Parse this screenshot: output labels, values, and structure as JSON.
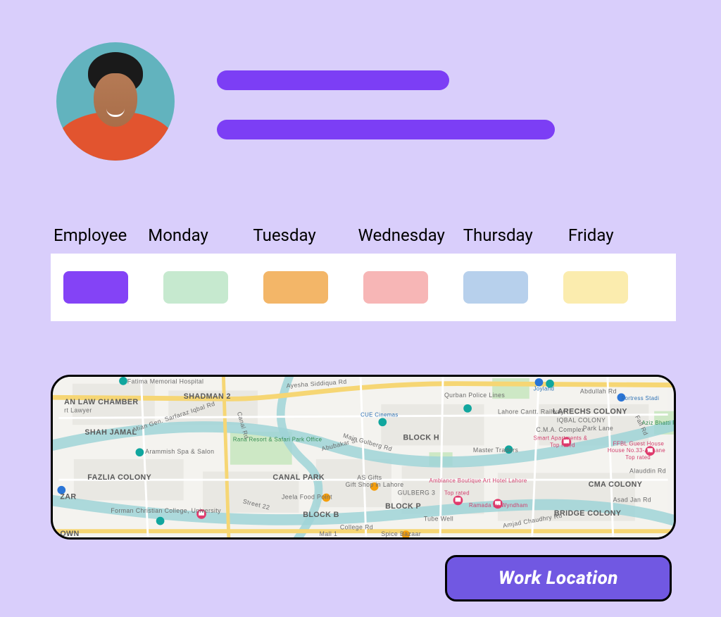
{
  "profile": {
    "avatar_desc": "Young man, curly dark hair, orange crew-neck shirt, teal background"
  },
  "schedule": {
    "headers": [
      "Employee",
      "Monday",
      "Tuesday",
      "Wednesday",
      "Thursday",
      "Friday"
    ],
    "chips": [
      "#8443F6",
      "#C6E9CF",
      "#F3B668",
      "#F7B6B6",
      "#B7D0EC",
      "#FBECAE"
    ]
  },
  "map": {
    "districts": {
      "law_chamber": "AN LAW CHAMBER",
      "shah_jamal": "SHAH JAMAL",
      "shadman2": "SHADMAN 2",
      "fazlia": "FAZLIA COLONY",
      "canal_park": "CANAL PARK",
      "block_b": "BLOCK B",
      "block_h": "BLOCK H",
      "block_p": "BLOCK P",
      "gulberg3": "GULBERG 3",
      "larechs": "LARECHS COLONY",
      "iqbal": "IQBAL COLONY",
      "cma": "CMA COLONY",
      "bridge": "BRIDGE COLONY",
      "zar": "ZAR",
      "own": "OWN"
    },
    "pois": {
      "fatima": "Fatima Memorial Hospital",
      "arammish": "Arammish Spa & Salon",
      "rana": "Rana Resort & Safari Park Office",
      "fcc": "Forman Christian College, University",
      "jeela": "Jeela Food Point",
      "asgifts_t": "AS Gifts",
      "asgifts_s": "Gift Shop in Lahore",
      "spice": "Spice Bazaar",
      "ambiance_t": "Ambiance Boutique Art Hotel Lahore",
      "toprated": "Top rated",
      "ramada": "Ramada by Wyndham",
      "master": "Master Traders",
      "cue": "CUE Cinemas",
      "qurban": "Qurban Police Lines",
      "cantt": "Lahore Cantt. Railway",
      "joyland": "Joyland",
      "fortress": "Fortress Stadi",
      "cma_complex": "C.M.A. Complex",
      "smart_t": "Smart Apartments &",
      "ffbl_t": "FFBL Guest House",
      "ffbl_s": "House No.33-A, Lane",
      "aziz": "Aziz Bhatti Park"
    },
    "roads": {
      "ayesha": "Ayesha Siddiqua Rd",
      "sarfaraz": "Mian Gen. Sarfaraz Iqbal Rd",
      "abubakar": "Abubakar St",
      "gulberg_main": "Main Gulberg Rd",
      "college": "College Rd",
      "tube": "Tube Well",
      "abdullah": "Abdullah Rd",
      "alauddin": "Alauddin Rd",
      "park_ln": "Park Lane",
      "amjad": "Amjad Chaudhry Rd",
      "fall": "Fall Rd",
      "asad": "Asad Jan Rd",
      "canal": "Canal Rd",
      "street22": "Street 22",
      "mall": "Mall 1"
    }
  },
  "button": {
    "work_location": "Work Location"
  }
}
